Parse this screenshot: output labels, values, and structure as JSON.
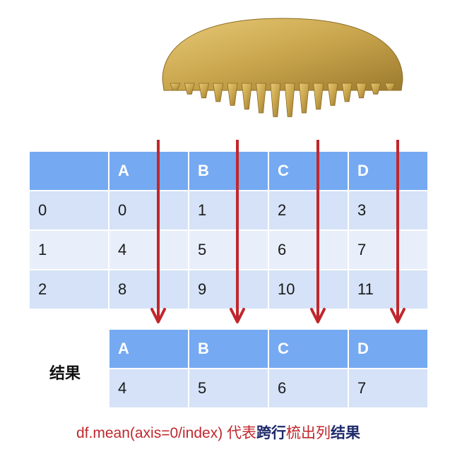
{
  "source_table": {
    "columns": [
      "",
      "A",
      "B",
      "C",
      "D"
    ],
    "rows": [
      [
        "0",
        "0",
        "1",
        "2",
        "3"
      ],
      [
        "1",
        "4",
        "5",
        "6",
        "7"
      ],
      [
        "2",
        "8",
        "9",
        "10",
        "11"
      ]
    ]
  },
  "result_table": {
    "label": "结果",
    "columns": [
      "A",
      "B",
      "C",
      "D"
    ],
    "values": [
      "4",
      "5",
      "6",
      "7"
    ]
  },
  "caption": {
    "part1": "df.mean(axis=0/index) 代表",
    "part2": "跨行",
    "part3": "梳出列",
    "part4": "结果"
  },
  "colors": {
    "header": "#75a9f2",
    "row_light": "#e9effa",
    "row_dark": "#d5e2f7",
    "arrow": "#c0272d",
    "comb": "#c9a64d"
  },
  "icons": {
    "comb": "comb-icon",
    "arrow": "down-arrow-icon"
  }
}
